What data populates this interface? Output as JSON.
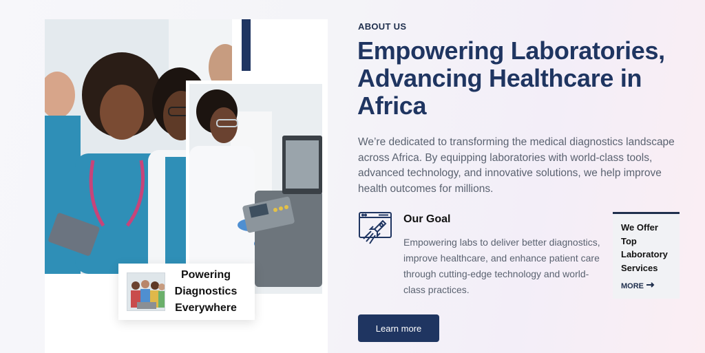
{
  "about": {
    "eyebrow": "ABOUT US",
    "headline": "Empowering Laboratories,\nAdvancing Healthcare in\nAfrica",
    "intro": "We’re dedicated to transforming the medical diagnostics landscape across Africa. By equipping laboratories with world-class tools, advanced technology, and innovative solutions, we help improve health outcomes for millions."
  },
  "goal": {
    "icon": "rocket-launch-icon",
    "title": "Our Goal",
    "text": "Empowering labs to deliver better diagnostics, improve healthcare, and enhance patient care through cutting-edge technology and world-class practices."
  },
  "cta": {
    "learn_more": "Learn more"
  },
  "offer": {
    "text": "We Offer\nTop\nLaboratory\nServices",
    "more": "MORE"
  },
  "caption": {
    "text": "Powering\nDiagnostics\nEverywhere"
  },
  "colors": {
    "navy": "#1f3561",
    "teal_scrubs": "#2f8fb7",
    "muted_text": "#5a6270"
  }
}
